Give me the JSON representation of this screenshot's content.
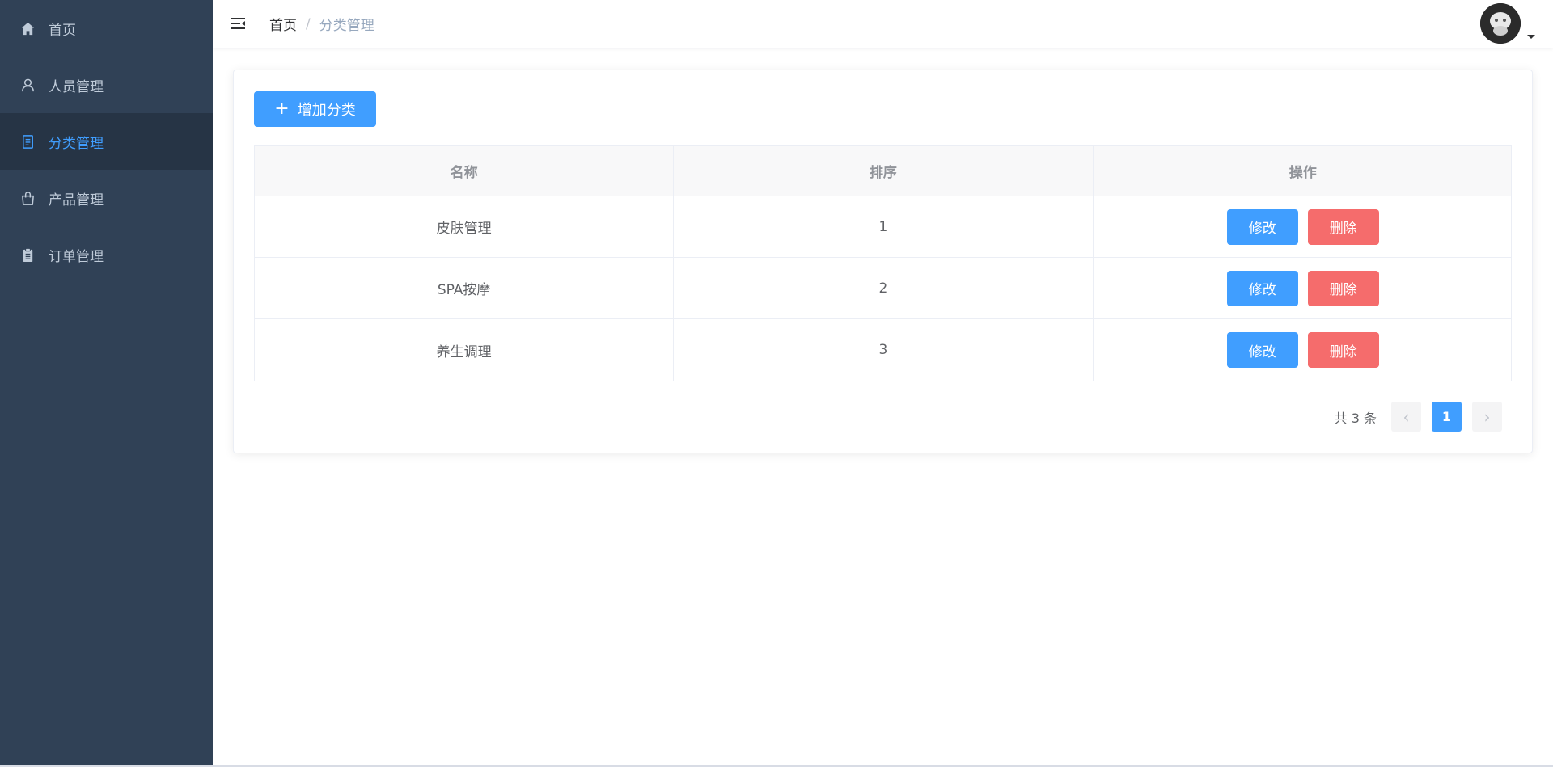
{
  "sidebar": {
    "items": [
      {
        "label": "首页",
        "icon": "home-icon"
      },
      {
        "label": "人员管理",
        "icon": "user-icon"
      },
      {
        "label": "分类管理",
        "icon": "document-icon",
        "active": true
      },
      {
        "label": "产品管理",
        "icon": "shopping-bag-icon"
      },
      {
        "label": "订单管理",
        "icon": "clipboard-icon"
      }
    ]
  },
  "navbar": {
    "breadcrumb": {
      "home": "首页",
      "separator": "/",
      "current": "分类管理"
    }
  },
  "toolbar": {
    "add_label": "增加分类",
    "add_icon": "+"
  },
  "table": {
    "headers": [
      "名称",
      "排序",
      "操作"
    ],
    "rows": [
      {
        "name": "皮肤管理",
        "sort": "1",
        "edit": "修改",
        "delete": "删除"
      },
      {
        "name": "SPA按摩",
        "sort": "2",
        "edit": "修改",
        "delete": "删除"
      },
      {
        "name": "养生调理",
        "sort": "3",
        "edit": "修改",
        "delete": "删除"
      }
    ]
  },
  "pagination": {
    "total": "共 3 条",
    "current_page": "1",
    "prev": "‹",
    "next": "›"
  },
  "colors": {
    "sidebar_bg": "#304156",
    "accent": "#409eff",
    "danger": "#f56c6c"
  }
}
